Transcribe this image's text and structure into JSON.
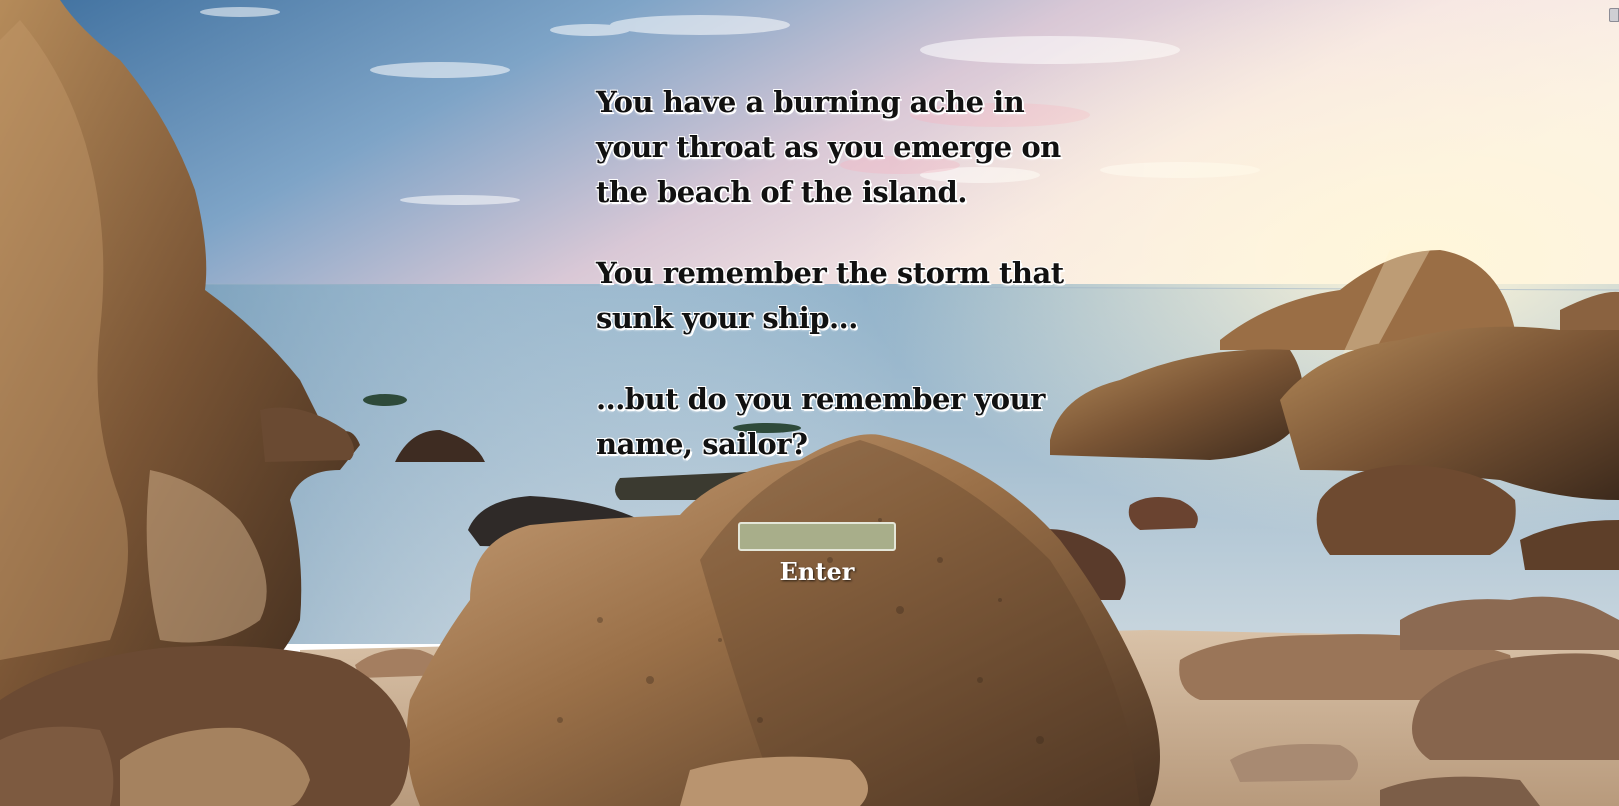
{
  "story": {
    "paragraph_1": "You have a burning ache in your throat as you emerge on the beach of the island.",
    "paragraph_2": "You remember the storm that sunk your ship...",
    "paragraph_3": "...but do you remember your name, sailor?"
  },
  "form": {
    "name_value": "",
    "enter_label": "Enter"
  },
  "colors": {
    "text": "#111111",
    "input_fill": "#a8ae8a",
    "button_text": "#ffffff"
  },
  "icons": {
    "corner": "speaker-icon"
  }
}
